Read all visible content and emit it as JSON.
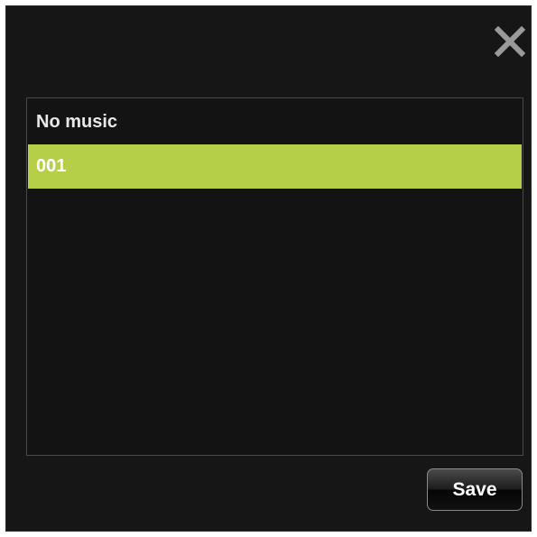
{
  "dialog": {
    "close_icon": "close-x-icon",
    "colors": {
      "background": "#161616",
      "selected_item": "#b5cf49",
      "list_border": "#4a4a4a"
    }
  },
  "music_list": {
    "items": [
      {
        "label": "No music",
        "selected": false
      },
      {
        "label": "001",
        "selected": true
      }
    ]
  },
  "actions": {
    "save_label": "Save"
  }
}
